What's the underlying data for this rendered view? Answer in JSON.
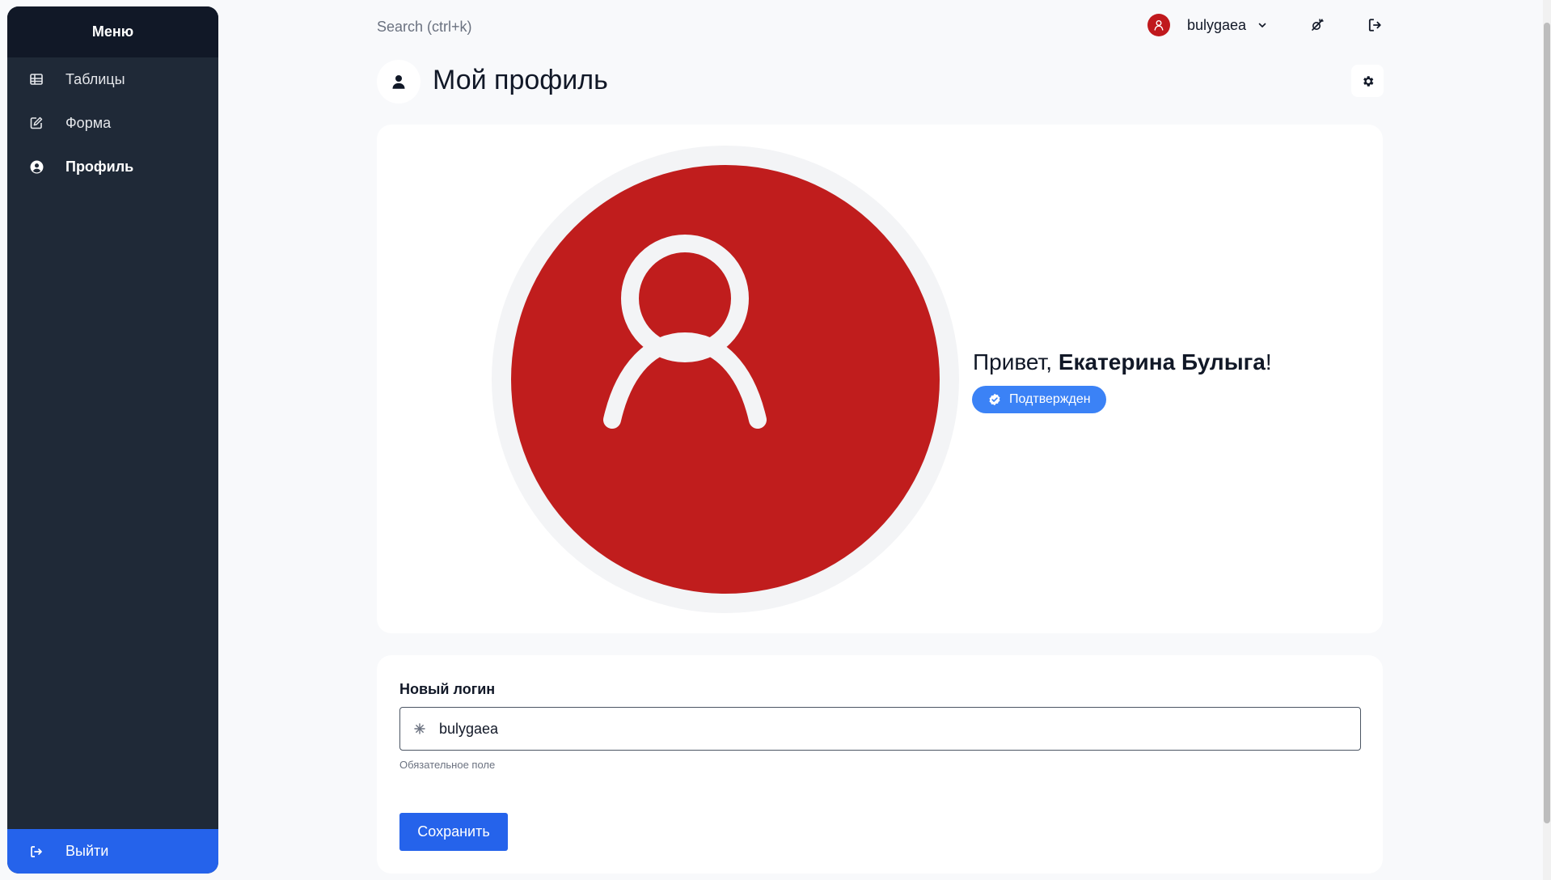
{
  "sidebar": {
    "title": "Меню",
    "items": [
      {
        "label": "Таблицы",
        "icon": "table-icon"
      },
      {
        "label": "Форма",
        "icon": "edit-icon"
      },
      {
        "label": "Профиль",
        "icon": "user-circle-icon"
      }
    ],
    "logout_label": "Выйти"
  },
  "header": {
    "search_placeholder": "Search (ctrl+k)",
    "username": "bulygaea"
  },
  "page": {
    "title": "Мой профиль"
  },
  "profile": {
    "greeting_prefix": "Привет, ",
    "full_name": "Екатерина Булыга",
    "greeting_suffix": "!",
    "badge_label": "Подтвержден",
    "avatar_color": "#c01d1d"
  },
  "form": {
    "login_label": "Новый логин",
    "login_value": "bulygaea",
    "login_hint": "Обязательное поле",
    "save_label": "Сохранить"
  },
  "colors": {
    "sidebar_bg": "#1f2937",
    "accent": "#2563eb",
    "badge": "#3b82f6"
  }
}
